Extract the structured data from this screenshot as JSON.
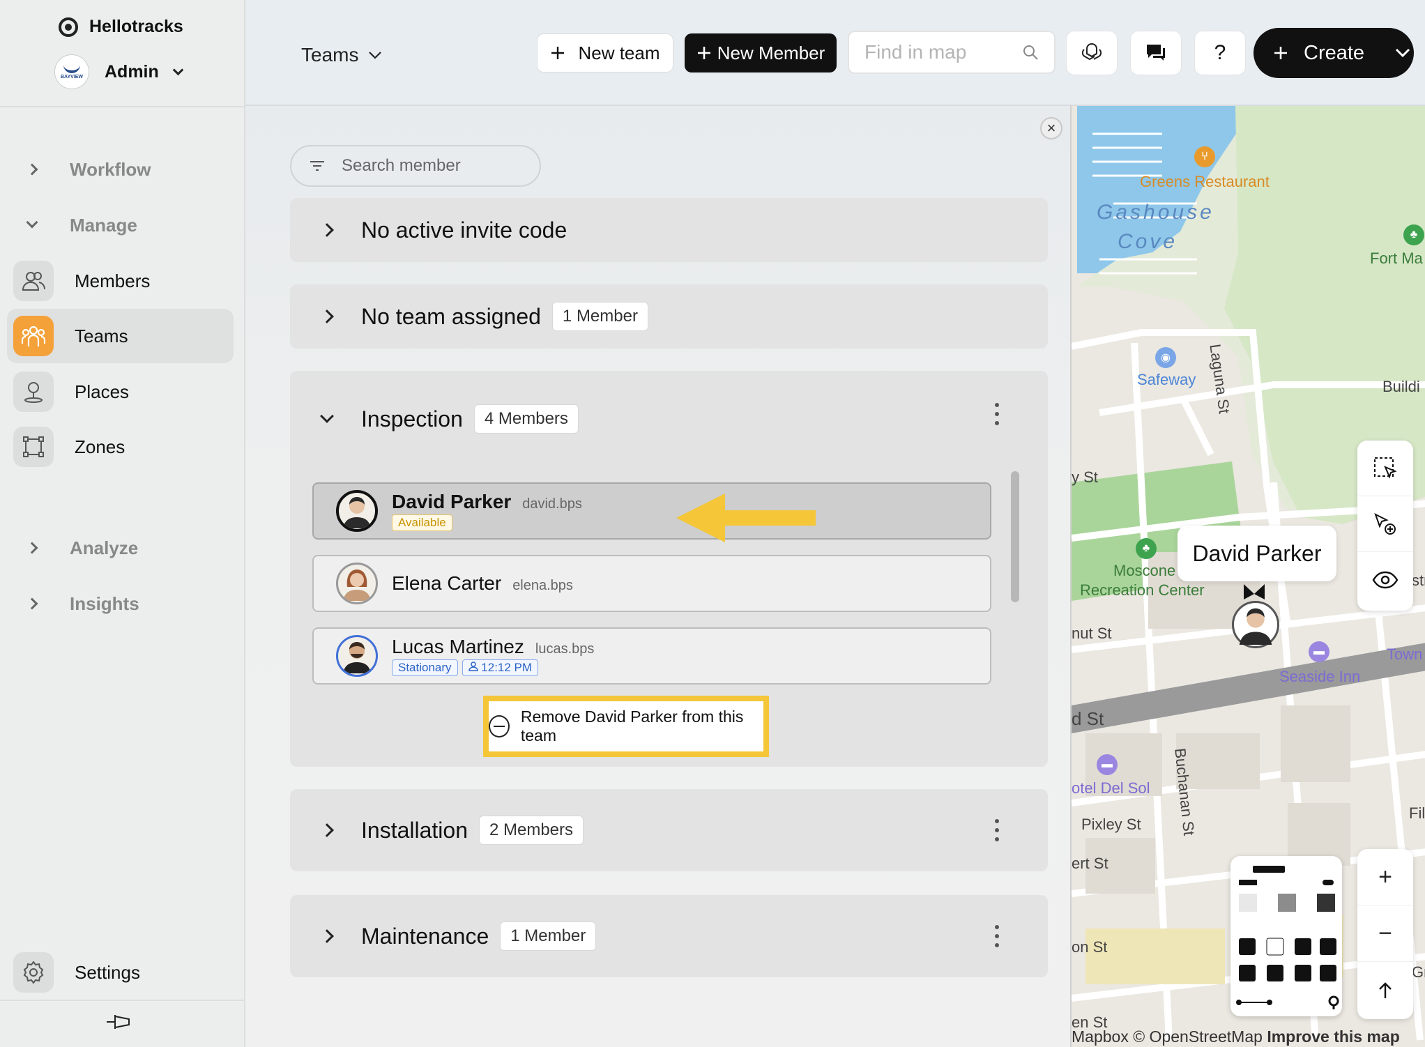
{
  "app": {
    "name": "Hellotracks",
    "org_name": "Admin",
    "org_logo_text": "BAYVIEW"
  },
  "sidebar": {
    "groups": [
      {
        "label": "Workflow"
      },
      {
        "label": "Manage"
      },
      {
        "label": "Analyze"
      },
      {
        "label": "Insights"
      }
    ],
    "items": [
      {
        "label": "Members",
        "icon": "members-icon"
      },
      {
        "label": "Teams",
        "icon": "teams-icon"
      },
      {
        "label": "Places",
        "icon": "places-icon"
      },
      {
        "label": "Zones",
        "icon": "zones-icon"
      }
    ],
    "settings_label": "Settings"
  },
  "topbar": {
    "view_label": "Teams",
    "new_team_label": "New team",
    "new_member_label": "New Member",
    "find_placeholder": "Find in map",
    "help_label": "?",
    "create_label": "Create"
  },
  "panel": {
    "search_placeholder": "Search member",
    "sections": [
      {
        "title": "No active invite code"
      },
      {
        "title": "No team assigned",
        "count": "1 Member"
      },
      {
        "title": "Inspection",
        "count": "4 Members"
      },
      {
        "title": "Installation",
        "count": "2 Members"
      },
      {
        "title": "Maintenance",
        "count": "1 Member"
      }
    ],
    "members": [
      {
        "name": "David Parker",
        "user": "david.bps",
        "status": "Available"
      },
      {
        "name": "Elena Carter",
        "user": "elena.bps"
      },
      {
        "name": "Lucas Martinez",
        "user": "lucas.bps",
        "status": "Stationary",
        "time": "12:12 PM"
      }
    ],
    "remove_label": "Remove David Parker from this team",
    "accent_color": "#f4c638"
  },
  "map": {
    "labels": {
      "greens": "Greens Restaurant",
      "gashouse": "Gashouse",
      "cove": "Cove",
      "fortma": "Fort Ma",
      "safeway": "Safeway",
      "laguna": "Laguna St",
      "buildi": "Buildi",
      "yst": "y St",
      "moscone1": "Moscone",
      "moscone2": "Recreation Center",
      "str": "str",
      "nutst": "nut St",
      "town": "Town",
      "seaside": "Seaside Inn",
      "dst": "d St",
      "buchanan": "Buchanan St",
      "delsol": "otel Del Sol",
      "fil": "Fil",
      "pixley": "Pixley St",
      "ertst": "ert St",
      "onst": "on St",
      "gr": "Gr",
      "enst": "en St"
    },
    "tooltip_name": "David Parker",
    "zoom_in": "+",
    "zoom_out": "−",
    "attribution": "Mapbox © OpenStreetMap",
    "improve": "Improve this map"
  }
}
